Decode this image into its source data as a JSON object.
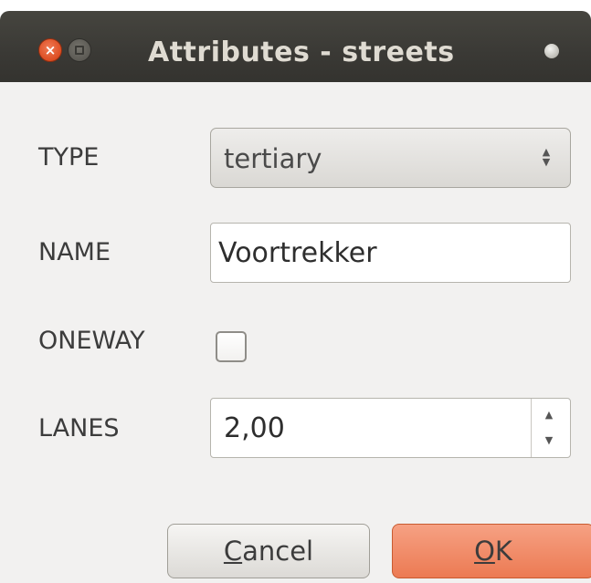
{
  "window": {
    "title": "Attributes - streets"
  },
  "fields": {
    "type": {
      "label": "TYPE",
      "value": "tertiary"
    },
    "name": {
      "label": "NAME",
      "value": "Voortrekker"
    },
    "oneway": {
      "label": "ONEWAY",
      "checked": false
    },
    "lanes": {
      "label": "LANES",
      "value": "2,00"
    }
  },
  "buttons": {
    "cancel_mnemonic": "C",
    "cancel_rest": "ancel",
    "ok_mnemonic": "O",
    "ok_rest": "K"
  },
  "icons": {
    "close": "close-icon",
    "minimize": "minimize-icon",
    "window_menu": "window-menu-icon",
    "spinner_up": "up-arrow-icon",
    "spinner_down": "down-arrow-icon"
  },
  "colors": {
    "titlebar": "#3c3b37",
    "close_button": "#e0582b",
    "ok_button": "#f08a64",
    "dialog_background": "#f2f1f0"
  }
}
